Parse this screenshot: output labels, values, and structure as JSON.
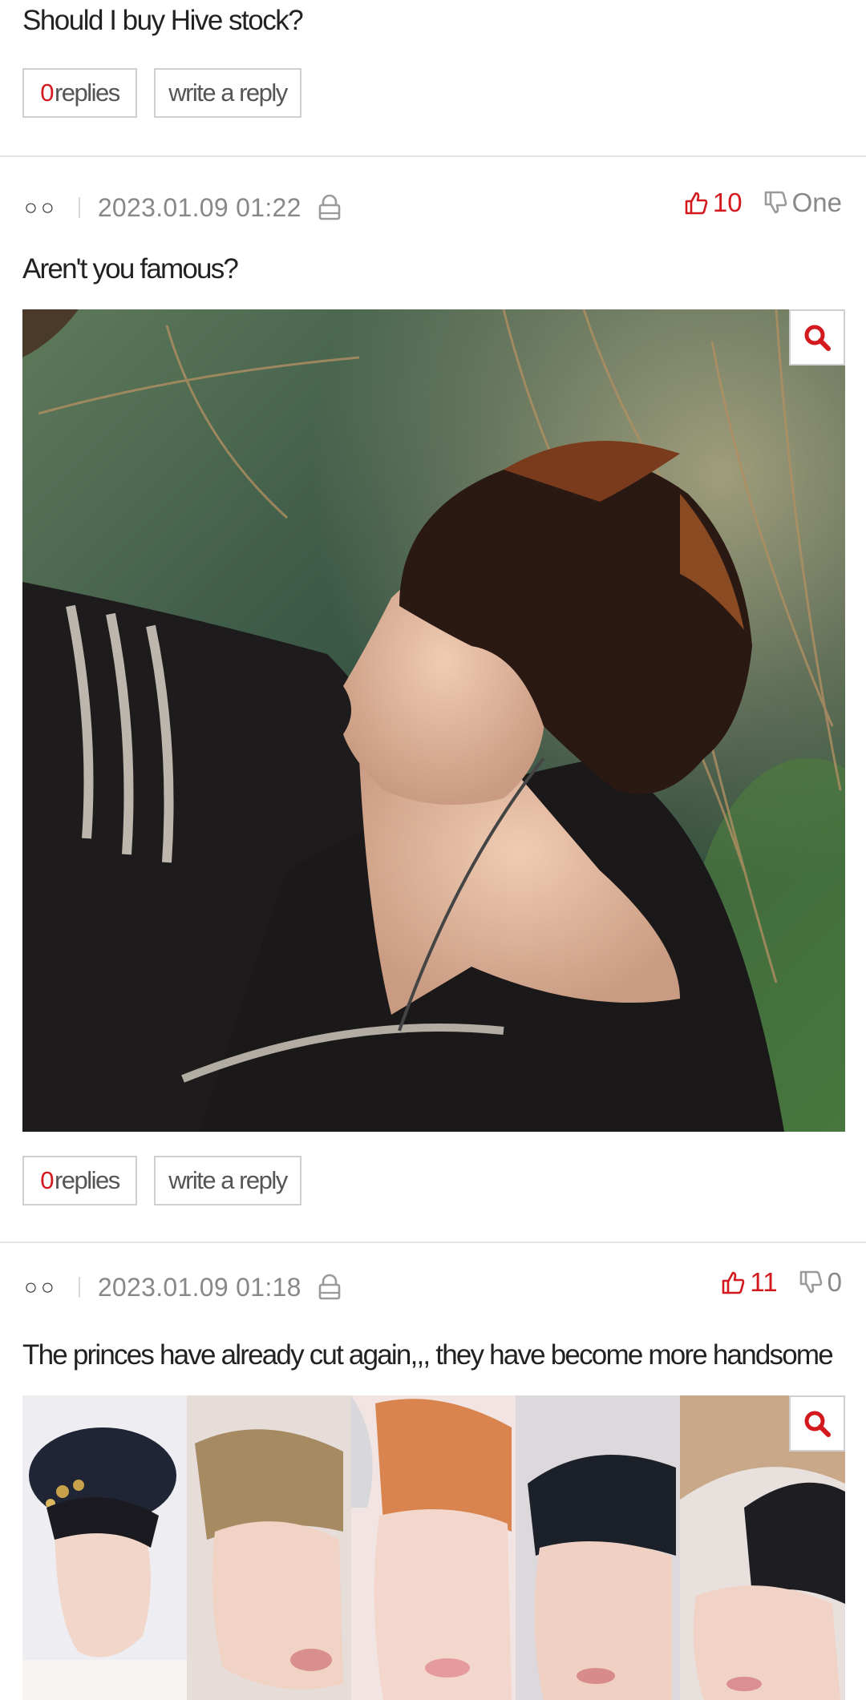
{
  "top_post": {
    "title": "Should I buy Hive stock?",
    "reply_count": "0",
    "replies_label": "replies",
    "write_reply_label": "write a reply"
  },
  "posts": [
    {
      "author": "○○",
      "date": "2023.01.09 01:22",
      "upvotes": "10",
      "downvotes": "One",
      "text": "Aren't you famous?",
      "reply_count": "0",
      "replies_label": "replies",
      "write_reply_label": "write a reply"
    },
    {
      "author": "○○",
      "date": "2023.01.09 01:18",
      "upvotes": "11",
      "downvotes": "0",
      "text": "The princes have already cut again,,, they have become more handsome"
    }
  ],
  "colors": {
    "accent": "#d3191d",
    "muted": "#888888",
    "border": "#cfcfcf"
  },
  "icons": [
    "lock-icon",
    "thumbs-up-icon",
    "thumbs-down-icon",
    "magnifier-icon"
  ]
}
